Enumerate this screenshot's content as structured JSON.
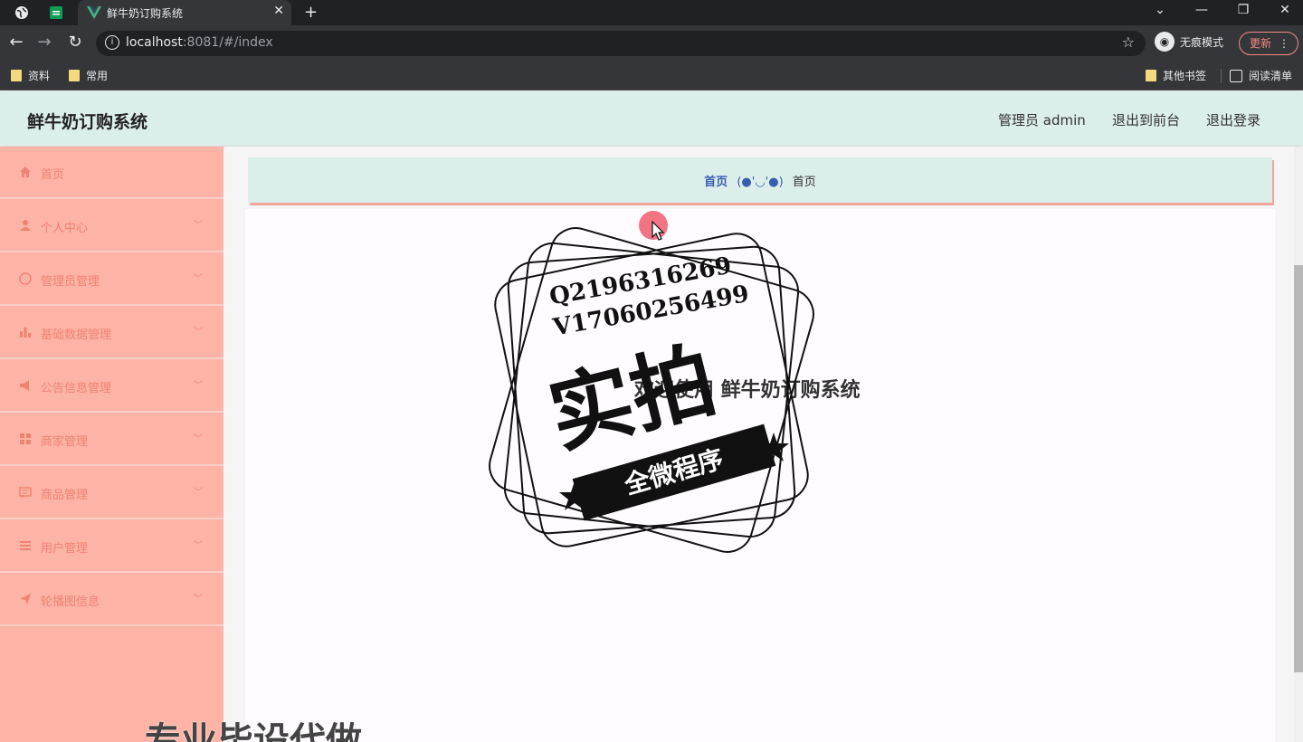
{
  "browser": {
    "tab_title": "鲜牛奶订购系统",
    "url_host": "localhost",
    "url_rest": ":8081/#/index",
    "incognito_label": "无痕模式",
    "update_label": "更新",
    "bookmarks": [
      "资料",
      "常用"
    ],
    "other_bookmarks": "其他书签",
    "reading_list": "阅读清单"
  },
  "header": {
    "title": "鲜牛奶订购系统",
    "user": "管理员 admin",
    "to_front": "退出到前台",
    "logout": "退出登录"
  },
  "sidebar": {
    "items": [
      {
        "label": "首页",
        "icon": "home-icon",
        "has_arrow": false
      },
      {
        "label": "个人中心",
        "icon": "user-icon",
        "has_arrow": true
      },
      {
        "label": "管理员管理",
        "icon": "compass-icon",
        "has_arrow": true
      },
      {
        "label": "基础数据管理",
        "icon": "chart-icon",
        "has_arrow": true
      },
      {
        "label": "公告信息管理",
        "icon": "megaphone-icon",
        "has_arrow": true
      },
      {
        "label": "商家管理",
        "icon": "grid-icon",
        "has_arrow": true
      },
      {
        "label": "商品管理",
        "icon": "message-icon",
        "has_arrow": true
      },
      {
        "label": "用户管理",
        "icon": "menu-icon",
        "has_arrow": true
      },
      {
        "label": "轮播图信息",
        "icon": "send-icon",
        "has_arrow": true
      }
    ]
  },
  "breadcrumb": {
    "home": "首页",
    "separator": "(●'◡'●)",
    "current": "首页"
  },
  "content": {
    "welcome": "欢迎使用 鲜牛奶订购系统"
  },
  "overlay": {
    "stamp_line1": "Q2196316269",
    "stamp_line2": "V17060256499",
    "stamp_big": "实拍",
    "stamp_ribbon": "全微程序",
    "watermark": "专业毕设代做"
  },
  "colors": {
    "sidebar_bg": "#fdb3a6",
    "sidebar_text": "#ef8372",
    "header_bg": "#dbeeea",
    "breadcrumb_link": "#3a5eae"
  }
}
